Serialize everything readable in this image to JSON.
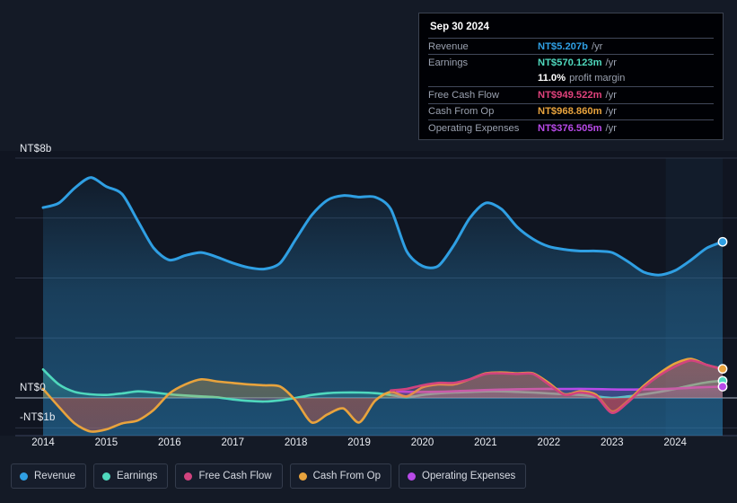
{
  "tooltip": {
    "date": "Sep 30 2024",
    "rows": [
      {
        "label": "Revenue",
        "value": "NT$5.207b",
        "unit": "/yr",
        "color": "#2f9fe3"
      },
      {
        "label": "Earnings",
        "value": "NT$570.123m",
        "unit": "/yr",
        "color": "#4fd8bd"
      },
      {
        "label": "",
        "value": "11.0%",
        "unit": "profit margin",
        "color": "#ffffff"
      },
      {
        "label": "Free Cash Flow",
        "value": "NT$949.522m",
        "unit": "/yr",
        "color": "#e0427c"
      },
      {
        "label": "Cash From Op",
        "value": "NT$968.860m",
        "unit": "/yr",
        "color": "#e8a33d"
      },
      {
        "label": "Operating Expenses",
        "value": "NT$376.505m",
        "unit": "/yr",
        "color": "#b84ae8"
      }
    ]
  },
  "legend": {
    "items": [
      {
        "label": "Revenue",
        "color": "#2f9fe3"
      },
      {
        "label": "Earnings",
        "color": "#4fd8bd"
      },
      {
        "label": "Free Cash Flow",
        "color": "#d1437e"
      },
      {
        "label": "Cash From Op",
        "color": "#e8a33d"
      },
      {
        "label": "Operating Expenses",
        "color": "#b84ae8"
      }
    ]
  },
  "chart_data": {
    "type": "area",
    "title": "",
    "xlabel": "",
    "ylabel": "",
    "grid": true,
    "legend_position": "bottom",
    "ylim": [
      -1.5,
      8.6
    ],
    "y_ticks": [
      8,
      0,
      -1
    ],
    "y_tick_labels": [
      "NT$8b",
      "NT$0",
      "-NT$1b"
    ],
    "y_gridlines": [
      8,
      6,
      4,
      2,
      0,
      -1
    ],
    "x_tick_labels": [
      "2014",
      "2015",
      "2016",
      "2017",
      "2018",
      "2019",
      "2020",
      "2021",
      "2022",
      "2023",
      "2024"
    ],
    "x_range": [
      2014,
      2024.75
    ],
    "forecast_start": 2023.85,
    "series": [
      {
        "name": "Revenue",
        "color": "#2f9fe3",
        "filled": true,
        "x": [
          2014.0,
          2014.25,
          2014.5,
          2014.75,
          2015.0,
          2015.25,
          2015.5,
          2015.75,
          2016.0,
          2016.25,
          2016.5,
          2016.75,
          2017.0,
          2017.25,
          2017.5,
          2017.75,
          2018.0,
          2018.25,
          2018.5,
          2018.75,
          2019.0,
          2019.25,
          2019.5,
          2019.75,
          2020.0,
          2020.25,
          2020.5,
          2020.75,
          2021.0,
          2021.25,
          2021.5,
          2021.75,
          2022.0,
          2022.25,
          2022.5,
          2022.75,
          2023.0,
          2023.25,
          2023.5,
          2023.75,
          2024.0,
          2024.25,
          2024.5,
          2024.75
        ],
        "values": [
          6.35,
          6.5,
          7.0,
          7.35,
          7.05,
          6.8,
          5.9,
          5.0,
          4.6,
          4.75,
          4.85,
          4.7,
          4.5,
          4.35,
          4.3,
          4.5,
          5.3,
          6.1,
          6.6,
          6.75,
          6.7,
          6.7,
          6.3,
          4.9,
          4.4,
          4.4,
          5.1,
          6.0,
          6.5,
          6.3,
          5.7,
          5.3,
          5.05,
          4.95,
          4.9,
          4.9,
          4.85,
          4.55,
          4.2,
          4.1,
          4.25,
          4.6,
          5.0,
          5.207
        ]
      },
      {
        "name": "Earnings",
        "color": "#4fd8bd",
        "filled": true,
        "x": [
          2014.0,
          2014.25,
          2014.5,
          2014.75,
          2015.0,
          2015.25,
          2015.5,
          2015.75,
          2016.0,
          2016.25,
          2016.5,
          2016.75,
          2017.0,
          2017.25,
          2017.5,
          2017.75,
          2018.0,
          2018.25,
          2018.5,
          2018.75,
          2019.0,
          2019.25,
          2019.5,
          2019.75,
          2020.0,
          2020.25,
          2020.5,
          2020.75,
          2021.0,
          2021.25,
          2021.5,
          2021.75,
          2022.0,
          2022.25,
          2022.5,
          2022.75,
          2023.0,
          2023.25,
          2023.5,
          2023.75,
          2024.0,
          2024.25,
          2024.5,
          2024.75
        ],
        "values": [
          0.95,
          0.45,
          0.2,
          0.12,
          0.1,
          0.15,
          0.22,
          0.18,
          0.12,
          0.08,
          0.05,
          0.02,
          -0.05,
          -0.1,
          -0.12,
          -0.08,
          0.0,
          0.1,
          0.16,
          0.18,
          0.18,
          0.16,
          0.1,
          0.02,
          0.1,
          0.15,
          0.18,
          0.2,
          0.22,
          0.22,
          0.2,
          0.18,
          0.15,
          0.12,
          0.1,
          0.05,
          0.0,
          0.05,
          0.12,
          0.2,
          0.3,
          0.42,
          0.52,
          0.57
        ]
      },
      {
        "name": "Free Cash Flow",
        "color": "#d1437e",
        "filled": true,
        "x": [
          2019.5,
          2019.75,
          2020.0,
          2020.25,
          2020.5,
          2020.75,
          2021.0,
          2021.25,
          2021.5,
          2021.75,
          2022.0,
          2022.25,
          2022.5,
          2022.75,
          2023.0,
          2023.25,
          2023.5,
          2023.75,
          2024.0,
          2024.25,
          2024.5,
          2024.75
        ],
        "values": [
          0.25,
          0.3,
          0.42,
          0.5,
          0.5,
          0.62,
          0.8,
          0.82,
          0.8,
          0.8,
          0.45,
          0.1,
          0.18,
          0.05,
          -0.5,
          -0.15,
          0.35,
          0.75,
          1.05,
          1.25,
          1.1,
          0.95
        ]
      },
      {
        "name": "Cash From Op",
        "color": "#e8a33d",
        "filled": true,
        "x": [
          2014.0,
          2014.25,
          2014.5,
          2014.75,
          2015.0,
          2015.25,
          2015.5,
          2015.75,
          2016.0,
          2016.25,
          2016.5,
          2016.75,
          2017.0,
          2017.25,
          2017.5,
          2017.75,
          2018.0,
          2018.25,
          2018.5,
          2018.75,
          2019.0,
          2019.25,
          2019.5,
          2019.75,
          2020.0,
          2020.25,
          2020.5,
          2020.75,
          2021.0,
          2021.25,
          2021.5,
          2021.75,
          2022.0,
          2022.25,
          2022.5,
          2022.75,
          2023.0,
          2023.25,
          2023.5,
          2023.75,
          2024.0,
          2024.25,
          2024.5,
          2024.75
        ],
        "values": [
          0.3,
          -0.3,
          -0.85,
          -1.12,
          -1.05,
          -0.85,
          -0.75,
          -0.4,
          0.15,
          0.45,
          0.62,
          0.55,
          0.5,
          0.45,
          0.42,
          0.38,
          -0.1,
          -0.82,
          -0.55,
          -0.35,
          -0.82,
          -0.1,
          0.2,
          0.05,
          0.35,
          0.45,
          0.45,
          0.62,
          0.82,
          0.85,
          0.82,
          0.82,
          0.5,
          0.12,
          0.22,
          0.1,
          -0.45,
          -0.1,
          0.4,
          0.82,
          1.15,
          1.3,
          1.1,
          0.969
        ]
      },
      {
        "name": "Operating Expenses",
        "color": "#b84ae8",
        "filled": true,
        "x": [
          2019.6,
          2019.85,
          2020.1,
          2020.35,
          2020.6,
          2020.85,
          2021.1,
          2021.35,
          2021.6,
          2021.85,
          2022.1,
          2022.35,
          2022.6,
          2022.85,
          2023.1,
          2023.35,
          2023.6,
          2023.85,
          2024.1,
          2024.35,
          2024.75
        ],
        "values": [
          0.22,
          0.2,
          0.2,
          0.21,
          0.23,
          0.25,
          0.27,
          0.28,
          0.29,
          0.3,
          0.3,
          0.3,
          0.3,
          0.29,
          0.28,
          0.28,
          0.29,
          0.3,
          0.32,
          0.35,
          0.376
        ]
      }
    ],
    "endpoints": [
      {
        "name": "Revenue",
        "color": "#2f9fe3",
        "x": 2024.75,
        "y": 5.207
      },
      {
        "name": "Cash From Op",
        "color": "#e8a33d",
        "x": 2024.75,
        "y": 0.969
      },
      {
        "name": "Earnings",
        "color": "#4fd8bd",
        "x": 2024.75,
        "y": 0.57
      },
      {
        "name": "Operating Expenses",
        "color": "#b84ae8",
        "x": 2024.75,
        "y": 0.376
      }
    ]
  }
}
